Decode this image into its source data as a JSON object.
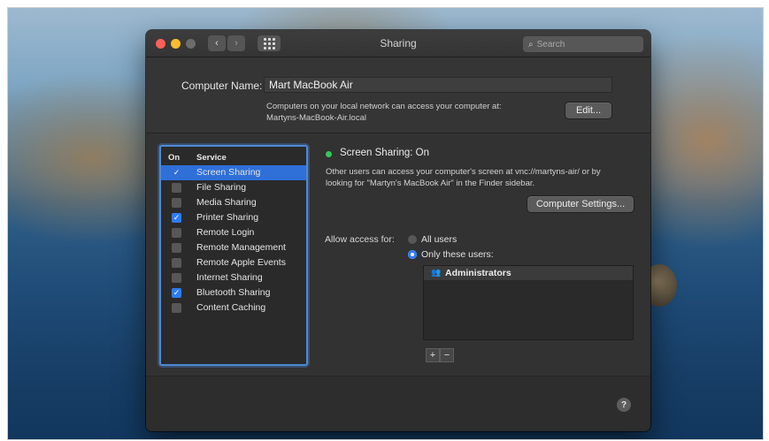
{
  "window": {
    "title": "Sharing",
    "search_placeholder": "Search",
    "nav_back": "‹",
    "nav_forward": "›"
  },
  "computer_name": {
    "label": "Computer Name:",
    "value": "Mart MacBook Air",
    "description_line1": "Computers on your local network can access your computer at:",
    "description_line2": "Martyns-MacBook-Air.local",
    "edit_label": "Edit..."
  },
  "services": {
    "header_on": "On",
    "header_service": "Service",
    "items": [
      {
        "name": "Screen Sharing",
        "checked": true,
        "selected": true
      },
      {
        "name": "File Sharing",
        "checked": false,
        "selected": false
      },
      {
        "name": "Media Sharing",
        "checked": false,
        "selected": false
      },
      {
        "name": "Printer Sharing",
        "checked": true,
        "selected": false
      },
      {
        "name": "Remote Login",
        "checked": false,
        "selected": false
      },
      {
        "name": "Remote Management",
        "checked": false,
        "selected": false
      },
      {
        "name": "Remote Apple Events",
        "checked": false,
        "selected": false
      },
      {
        "name": "Internet Sharing",
        "checked": false,
        "selected": false
      },
      {
        "name": "Bluetooth Sharing",
        "checked": true,
        "selected": false
      },
      {
        "name": "Content Caching",
        "checked": false,
        "selected": false
      }
    ]
  },
  "detail": {
    "status": "Screen Sharing: On",
    "status_color": "#35c759",
    "description_line1": "Other users can access your computer's screen at vnc://martyns-air/ or by",
    "description_line2": "looking for \"Martyn's MacBook Air\" in the Finder sidebar.",
    "settings_button": "Computer Settings...",
    "allow_label": "Allow access for:",
    "radio_all": "All users",
    "radio_only": "Only these users:",
    "selected_radio": "only",
    "users": [
      "Administrators"
    ],
    "plus": "+",
    "minus": "−"
  },
  "help_label": "?"
}
